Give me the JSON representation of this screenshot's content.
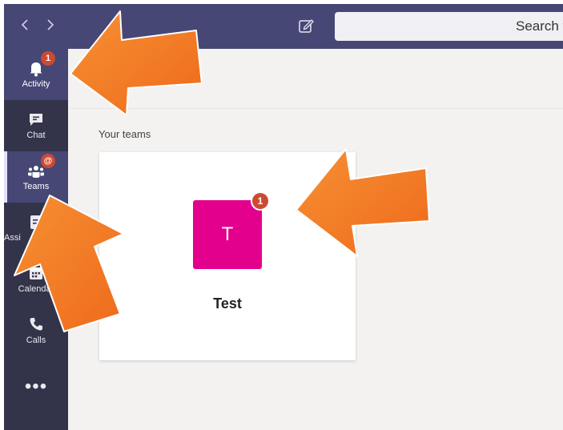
{
  "topbar": {
    "back_icon": "chevron-left-icon",
    "forward_icon": "chevron-right-icon",
    "compose_icon": "compose-icon",
    "search_placeholder": "Search f"
  },
  "rail": {
    "items": [
      {
        "label": "Activity",
        "icon": "bell-icon",
        "badge": "1"
      },
      {
        "label": "Chat",
        "icon": "chat-icon"
      },
      {
        "label": "Teams",
        "icon": "teams-icon",
        "badge": "@"
      },
      {
        "label": "Assi",
        "icon": "assignments-icon"
      },
      {
        "label": "Calendar",
        "icon": "calendar-icon"
      },
      {
        "label": "Calls",
        "icon": "phone-icon"
      }
    ],
    "more_label": "•••"
  },
  "main": {
    "section_title": "Your teams",
    "team": {
      "initial": "T",
      "name": "Test",
      "badge": "1"
    }
  },
  "colors": {
    "header": "#464775",
    "rail": "#33344a",
    "team_avatar": "#e3008c",
    "badge": "#cc4a31",
    "annotation_arrow": "#f47b20"
  }
}
